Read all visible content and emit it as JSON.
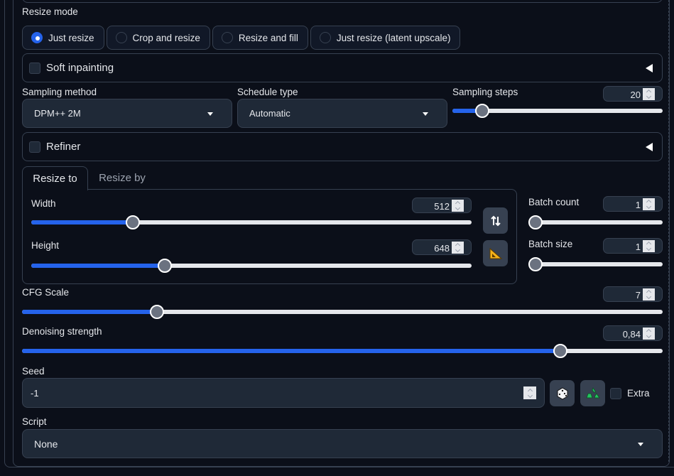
{
  "resize_mode": {
    "label": "Resize mode",
    "options": [
      "Just resize",
      "Crop and resize",
      "Resize and fill",
      "Just resize (latent upscale)"
    ],
    "selected": "Just resize"
  },
  "soft_inpainting": {
    "label": "Soft inpainting",
    "checked": false
  },
  "sampling_method": {
    "label": "Sampling method",
    "value": "DPM++ 2M"
  },
  "schedule_type": {
    "label": "Schedule type",
    "value": "Automatic"
  },
  "sampling_steps": {
    "label": "Sampling steps",
    "value": "20",
    "fraction": 0.1414
  },
  "refiner": {
    "label": "Refiner",
    "checked": false
  },
  "resize_tabs": {
    "tabs": [
      "Resize to",
      "Resize by"
    ],
    "active": "Resize to"
  },
  "width": {
    "label": "Width",
    "value": "512",
    "fraction": 0.2308
  },
  "height": {
    "label": "Height",
    "value": "648",
    "fraction": 0.3026
  },
  "batch_count": {
    "label": "Batch count",
    "value": "1",
    "fraction": 0.0
  },
  "batch_size": {
    "label": "Batch size",
    "value": "1",
    "fraction": 0.0
  },
  "cfg_scale": {
    "label": "CFG Scale",
    "value": "7",
    "fraction": 0.2105
  },
  "denoising_strength": {
    "label": "Denoising strength",
    "value": "0,84",
    "fraction": 0.84
  },
  "seed": {
    "label": "Seed",
    "value": "-1",
    "extra_label": "Extra"
  },
  "script": {
    "label": "Script",
    "value": "None"
  },
  "icons": {
    "swap": "swap-dimensions-icon",
    "ruler": "triangle-ruler-icon",
    "dice": "dice-icon",
    "recycle": "recycle-icon"
  }
}
